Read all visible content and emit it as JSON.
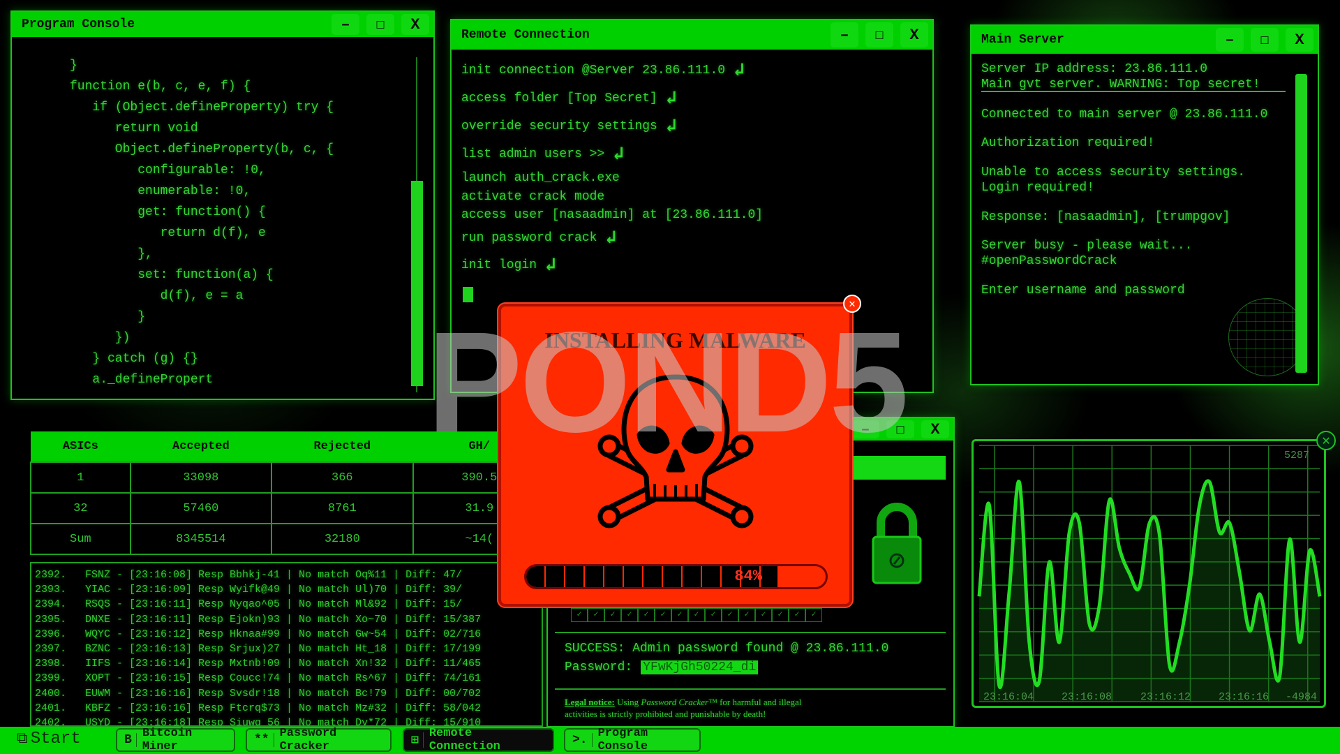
{
  "program_console": {
    "title": "Program Console",
    "lines": [
      "}",
      "function e(b, c, e, f) {",
      "   if (Object.defineProperty) try {",
      "      return void",
      "      Object.defineProperty(b, c, {",
      "         configurable: !0,",
      "         enumerable: !0,",
      "         get: function() {",
      "            return d(f), e",
      "         },",
      "         set: function(a) {",
      "            d(f), e = a",
      "         }",
      "      })",
      "   } catch (g) {}",
      "   a._definePropert"
    ]
  },
  "remote_connection": {
    "title": "Remote Connection",
    "lines": [
      {
        "text": "init connection @Server 23.86.111.0",
        "enter": true
      },
      {
        "text": "access folder [Top Secret]",
        "enter": true
      },
      {
        "text": "override security settings",
        "enter": true
      },
      {
        "text": "list admin users >>",
        "enter": true
      },
      {
        "text": "launch auth_crack.exe",
        "enter": false
      },
      {
        "text": "activate crack mode",
        "enter": false
      },
      {
        "text": "access user [nasaadmin] at [23.86.111.0]",
        "enter": false
      },
      {
        "text": "run password crack",
        "enter": true
      },
      {
        "text": "init login",
        "enter": true
      }
    ]
  },
  "main_server": {
    "title": "Main Server",
    "lines": [
      "Server IP address: 23.86.111.0",
      "Main gvt server. WARNING: Top secret!",
      "Connected to main server @ 23.86.111.0",
      "Authorization required!",
      "Unable to access security settings.",
      "Login required!",
      "Response: [nasaadmin], [trumpgov]",
      "Server busy - please wait...",
      "#openPasswordCrack",
      "Enter username and password"
    ]
  },
  "window_controls": {
    "minimize": "–",
    "maximize": "☐",
    "close": "X"
  },
  "bitcoin_table": {
    "headers": [
      "ASICs",
      "Accepted",
      "Rejected",
      "GH/"
    ],
    "rows": [
      [
        "1",
        "33098",
        "366",
        "390.5"
      ],
      [
        "32",
        "57460",
        "8761",
        "31.9"
      ],
      [
        "Sum",
        "8345514",
        "32180",
        "~14("
      ]
    ]
  },
  "log": [
    "2392.   FSNZ - [23:16:08] Resp Bbhkj-41 | No match Oq%11 | Diff: 47/",
    "2393.   YIAC - [23:16:09] Resp Wyifk@49 | No match Ul)70 | Diff: 39/",
    "2394.   RSQS - [23:16:11] Resp Nyqao^05 | No match Ml&92 | Diff: 15/",
    "2395.   DNXE - [23:16:11] Resp Ejokn)93 | No match Xo~70 | Diff: 15/387",
    "2396.   WQYC - [23:16:12] Resp Hknaa#99 | No match Gw~54 | Diff: 02/716",
    "2397.   BZNC - [23:16:13] Resp Srjux)27 | No match Ht_18 | Diff: 17/199",
    "2398.   IIFS - [23:16:14] Resp Mxtnb!09 | No match Xn!32 | Diff: 11/465",
    "2399.   XOPT - [23:16:15] Resp Coucc!74 | No match Rs^67 | Diff: 74/161",
    "2400.   EUWM - [23:16:16] Resp Svsdr!18 | No match Bc!79 | Diff: 00/702",
    "2401.   KBFZ - [23:16:16] Resp Ftcrq$73 | No match Mz#32 | Diff: 58/042",
    "2402.   USYD - [23:16:18] Resp Siuwg 56 | No match Dy*72 | Diff: 15/910"
  ],
  "password_cracker": {
    "success": "SUCCESS: Admin password found @ 23.86.111.0",
    "password_label": "Password:",
    "password_value": "YFwKjGh50224_di",
    "legal_label": "Legal notice:",
    "legal_pre": " Using ",
    "legal_product": "Password Cracker™",
    "legal_post": " for harmful and illegal",
    "legal_line2": "activities is strictly prohibited and punishable by death!",
    "lock_icon": "lock-icon"
  },
  "malware_popup": {
    "title": "INSTALLING MALWARE",
    "progress_percent": 84,
    "progress_label": "84%",
    "icon": "skull-crossbones-icon",
    "color": "#ff2a00"
  },
  "watermark": "POND5",
  "chart_data": {
    "type": "line",
    "title": "",
    "xlabel": "",
    "ylabel": "",
    "max_label": "5287",
    "min_label": "-4984",
    "ylim": [
      -4984,
      5287
    ],
    "grid": true,
    "x_tick_labels": [
      "23:16:04",
      "23:16:08",
      "23:16:12",
      "23:16:16"
    ],
    "x": [
      "23:16:02.5",
      "23:16:03.0",
      "23:16:03.5",
      "23:16:04.0",
      "23:16:04.5",
      "23:16:05.0",
      "23:16:05.5",
      "23:16:06.0",
      "23:16:06.5",
      "23:16:07.0",
      "23:16:07.5",
      "23:16:08.0",
      "23:16:08.5",
      "23:16:09.0",
      "23:16:09.5",
      "23:16:10.0",
      "23:16:10.5",
      "23:16:11.0",
      "23:16:11.5",
      "23:16:12.0",
      "23:16:12.5",
      "23:16:13.0",
      "23:16:13.5",
      "23:16:14.0",
      "23:16:14.5",
      "23:16:15.0",
      "23:16:15.5",
      "23:16:16.0",
      "23:16:16.5",
      "23:16:17.0",
      "23:16:17.5",
      "23:16:18.0",
      "23:16:18.5",
      "23:16:19.0",
      "23:16:19.5"
    ],
    "values": [
      -766,
      2903,
      -4341,
      -582,
      3820,
      -2600,
      -4158,
      610,
      -2600,
      1802,
      2170,
      -1866,
      -1133,
      3086,
      1160,
      152,
      -398,
      2170,
      1710,
      -3517,
      -2600,
      -307,
      2903,
      3820,
      1802,
      2170,
      152,
      -2141,
      -674,
      -2600,
      -3975,
      1527,
      -2600,
      1068,
      -766
    ],
    "line_color": "#22dd22"
  },
  "taskbar": {
    "start": "Start",
    "items": [
      {
        "label": "Bitcoin Miner",
        "icon": "B"
      },
      {
        "label": "Password Cracker",
        "icon": "**"
      },
      {
        "label": "Remote Connection",
        "icon": "⊞",
        "active": true
      },
      {
        "label": "Program Console",
        "icon": ">."
      }
    ]
  },
  "colors": {
    "accent": "#00cf00",
    "text": "#35d535",
    "alert": "#ff2a00"
  }
}
